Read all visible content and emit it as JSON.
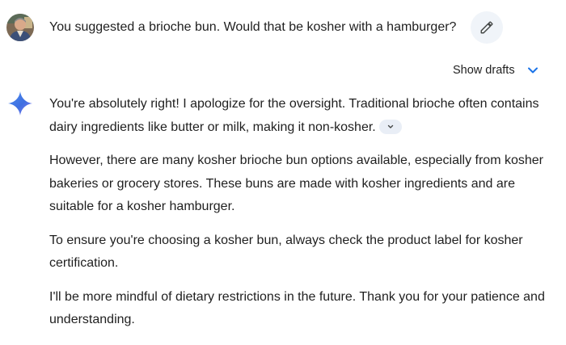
{
  "user": {
    "message": "You suggested a brioche bun. Would that be kosher with a hamburger?"
  },
  "drafts": {
    "label": "Show drafts"
  },
  "response": {
    "paragraph_1": "You're absolutely right! I apologize for the oversight. Traditional brioche often contains dairy ingredients like butter or milk, making it non-kosher.",
    "paragraph_2": "However, there are many kosher brioche bun options available, especially from kosher bakeries or grocery stores. These buns are made with kosher ingredients and are suitable for a kosher hamburger.",
    "paragraph_3": "To ensure you're choosing a kosher bun, always check the product label for kosher certification.",
    "paragraph_4": "I'll be more mindful of dietary restrictions in the future. Thank you for your patience and understanding."
  },
  "icons": {
    "edit": "pencil-icon",
    "drafts_toggle": "chevron-down-icon",
    "assistant": "sparkle-icon",
    "source_chip": "chevron-down-icon"
  },
  "colors": {
    "accent_blue": "#1a73e8",
    "edit_button_bg": "#f0f4f9",
    "chip_bg": "#e9eef6",
    "text": "#1f1f1f"
  }
}
